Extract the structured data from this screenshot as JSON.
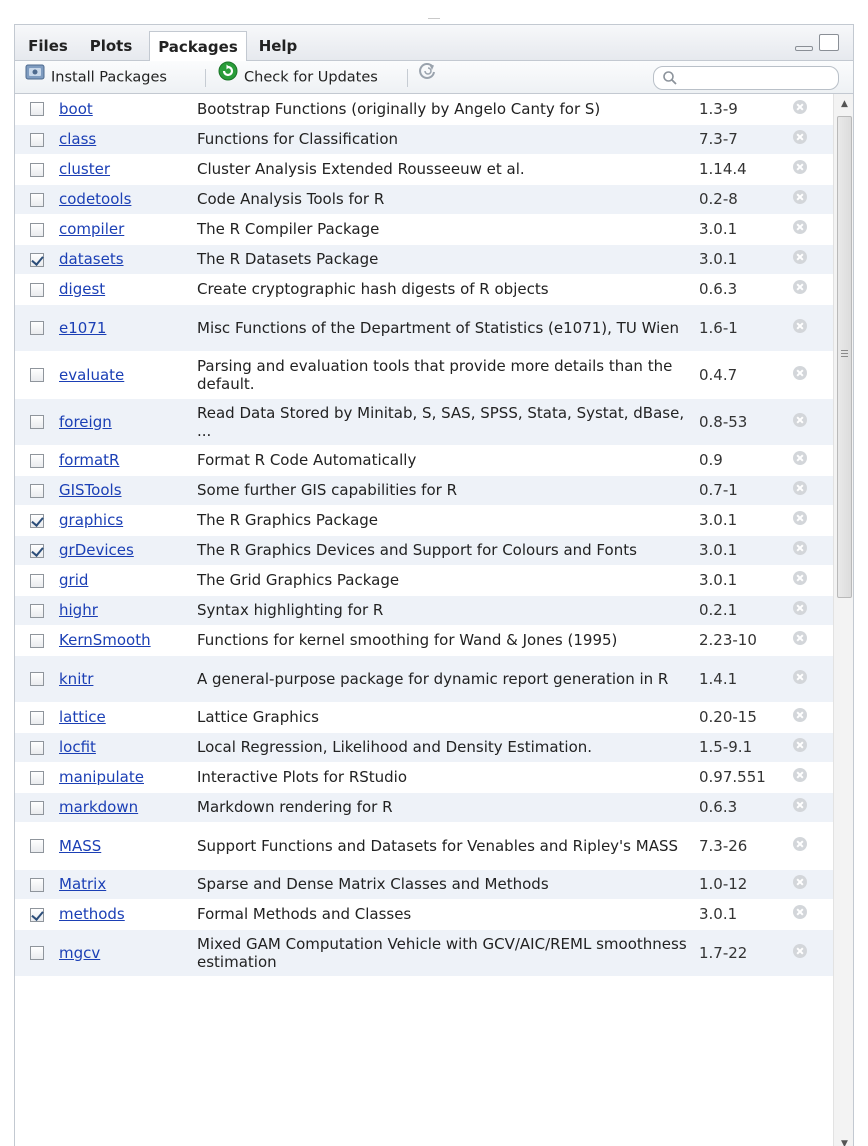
{
  "tabs": [
    {
      "label": "Files",
      "active": false
    },
    {
      "label": "Plots",
      "active": false
    },
    {
      "label": "Packages",
      "active": true
    },
    {
      "label": "Help",
      "active": false
    }
  ],
  "toolbar": {
    "install_label": "Install Packages",
    "update_label": "Check for Updates",
    "search_placeholder": "",
    "refresh_icon": "refresh-icon"
  },
  "colors": {
    "link": "#1b3fb5",
    "row_alt": "#eef2f8",
    "update_icon": "#2a9d3a"
  },
  "packages": [
    {
      "name": "boot",
      "desc": "Bootstrap Functions (originally by Angelo Canty for S)",
      "version": "1.3-9",
      "checked": false
    },
    {
      "name": "class",
      "desc": "Functions for Classification",
      "version": "7.3-7",
      "checked": false
    },
    {
      "name": "cluster",
      "desc": "Cluster Analysis Extended Rousseeuw et al.",
      "version": "1.14.4",
      "checked": false
    },
    {
      "name": "codetools",
      "desc": "Code Analysis Tools for R",
      "version": "0.2-8",
      "checked": false
    },
    {
      "name": "compiler",
      "desc": "The R Compiler Package",
      "version": "3.0.1",
      "checked": false
    },
    {
      "name": "datasets",
      "desc": "The R Datasets Package",
      "version": "3.0.1",
      "checked": true
    },
    {
      "name": "digest",
      "desc": "Create cryptographic hash digests of R objects",
      "version": "0.6.3",
      "checked": false
    },
    {
      "name": "e1071",
      "desc": "Misc Functions of the Department of Statistics (e1071), TU Wien",
      "version": "1.6-1",
      "checked": false
    },
    {
      "name": "evaluate",
      "desc": "Parsing and evaluation tools that provide more details than the default.",
      "version": "0.4.7",
      "checked": false
    },
    {
      "name": "foreign",
      "desc": "Read Data Stored by Minitab, S, SAS, SPSS, Stata, Systat, dBase, ...",
      "version": "0.8-53",
      "checked": false
    },
    {
      "name": "formatR",
      "desc": "Format R Code Automatically",
      "version": "0.9",
      "checked": false
    },
    {
      "name": "GISTools",
      "desc": "Some further GIS capabilities for R",
      "version": "0.7-1",
      "checked": false
    },
    {
      "name": "graphics",
      "desc": "The R Graphics Package",
      "version": "3.0.1",
      "checked": true
    },
    {
      "name": "grDevices",
      "desc": "The R Graphics Devices and Support for Colours and Fonts",
      "version": "3.0.1",
      "checked": true
    },
    {
      "name": "grid",
      "desc": "The Grid Graphics Package",
      "version": "3.0.1",
      "checked": false
    },
    {
      "name": "highr",
      "desc": "Syntax highlighting for R",
      "version": "0.2.1",
      "checked": false
    },
    {
      "name": "KernSmooth",
      "desc": "Functions for kernel smoothing for Wand & Jones (1995)",
      "version": "2.23-10",
      "checked": false
    },
    {
      "name": "knitr",
      "desc": "A general-purpose package for dynamic report generation in R",
      "version": "1.4.1",
      "checked": false
    },
    {
      "name": "lattice",
      "desc": "Lattice Graphics",
      "version": "0.20-15",
      "checked": false
    },
    {
      "name": "locfit",
      "desc": "Local Regression, Likelihood and Density Estimation.",
      "version": "1.5-9.1",
      "checked": false
    },
    {
      "name": "manipulate",
      "desc": "Interactive Plots for RStudio",
      "version": "0.97.551",
      "checked": false
    },
    {
      "name": "markdown",
      "desc": "Markdown rendering for R",
      "version": "0.6.3",
      "checked": false
    },
    {
      "name": "MASS",
      "desc": "Support Functions and Datasets for Venables and Ripley's MASS",
      "version": "7.3-26",
      "checked": false
    },
    {
      "name": "Matrix",
      "desc": "Sparse and Dense Matrix Classes and Methods",
      "version": "1.0-12",
      "checked": false
    },
    {
      "name": "methods",
      "desc": "Formal Methods and Classes",
      "version": "3.0.1",
      "checked": true
    },
    {
      "name": "mgcv",
      "desc": "Mixed GAM Computation Vehicle with GCV/AIC/REML smoothness estimation",
      "version": "1.7-22",
      "checked": false
    }
  ]
}
